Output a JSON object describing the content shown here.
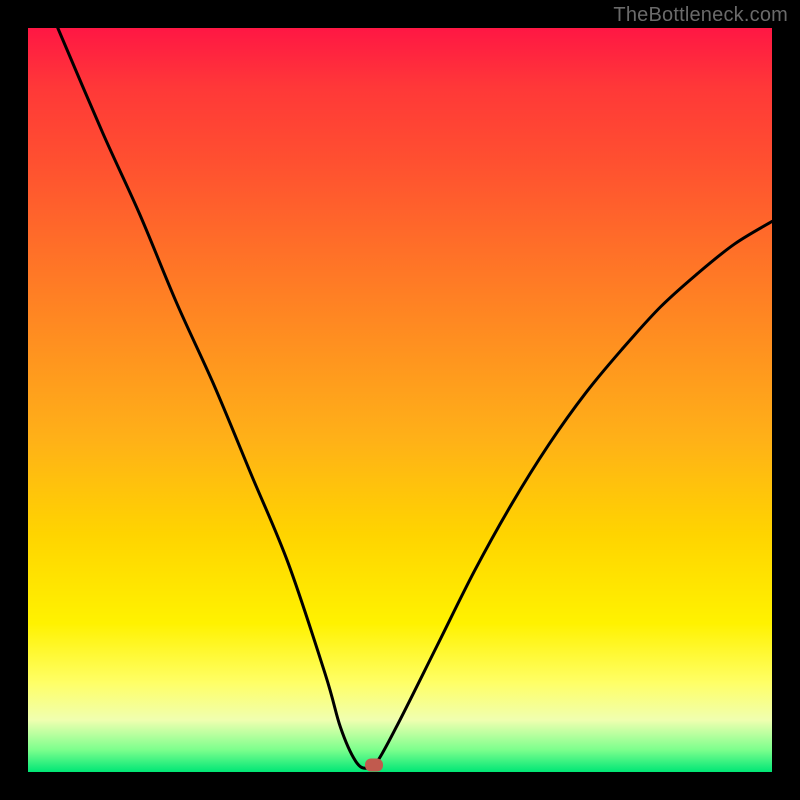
{
  "watermark": "TheBottleneck.com",
  "chart_data": {
    "type": "line",
    "title": "",
    "xlabel": "",
    "ylabel": "",
    "xlim": [
      0,
      100
    ],
    "ylim": [
      0,
      100
    ],
    "series": [
      {
        "name": "bottleneck-curve",
        "x": [
          4,
          10,
          15,
          20,
          25,
          30,
          35,
          40,
          42,
          44,
          45.5,
          47,
          50,
          55,
          60,
          65,
          70,
          75,
          80,
          85,
          90,
          95,
          100
        ],
        "values": [
          100,
          86,
          75,
          63,
          52,
          40,
          28,
          13,
          6,
          1.5,
          0.5,
          1.5,
          7,
          17,
          27,
          36,
          44,
          51,
          57,
          62.5,
          67,
          71,
          74
        ]
      }
    ],
    "marker": {
      "x": 46.5,
      "y": 1
    },
    "gradient_stops": [
      {
        "pct": 0,
        "color": "#ff1744"
      },
      {
        "pct": 50,
        "color": "#ffb018"
      },
      {
        "pct": 80,
        "color": "#fff200"
      },
      {
        "pct": 100,
        "color": "#00e676"
      }
    ]
  }
}
